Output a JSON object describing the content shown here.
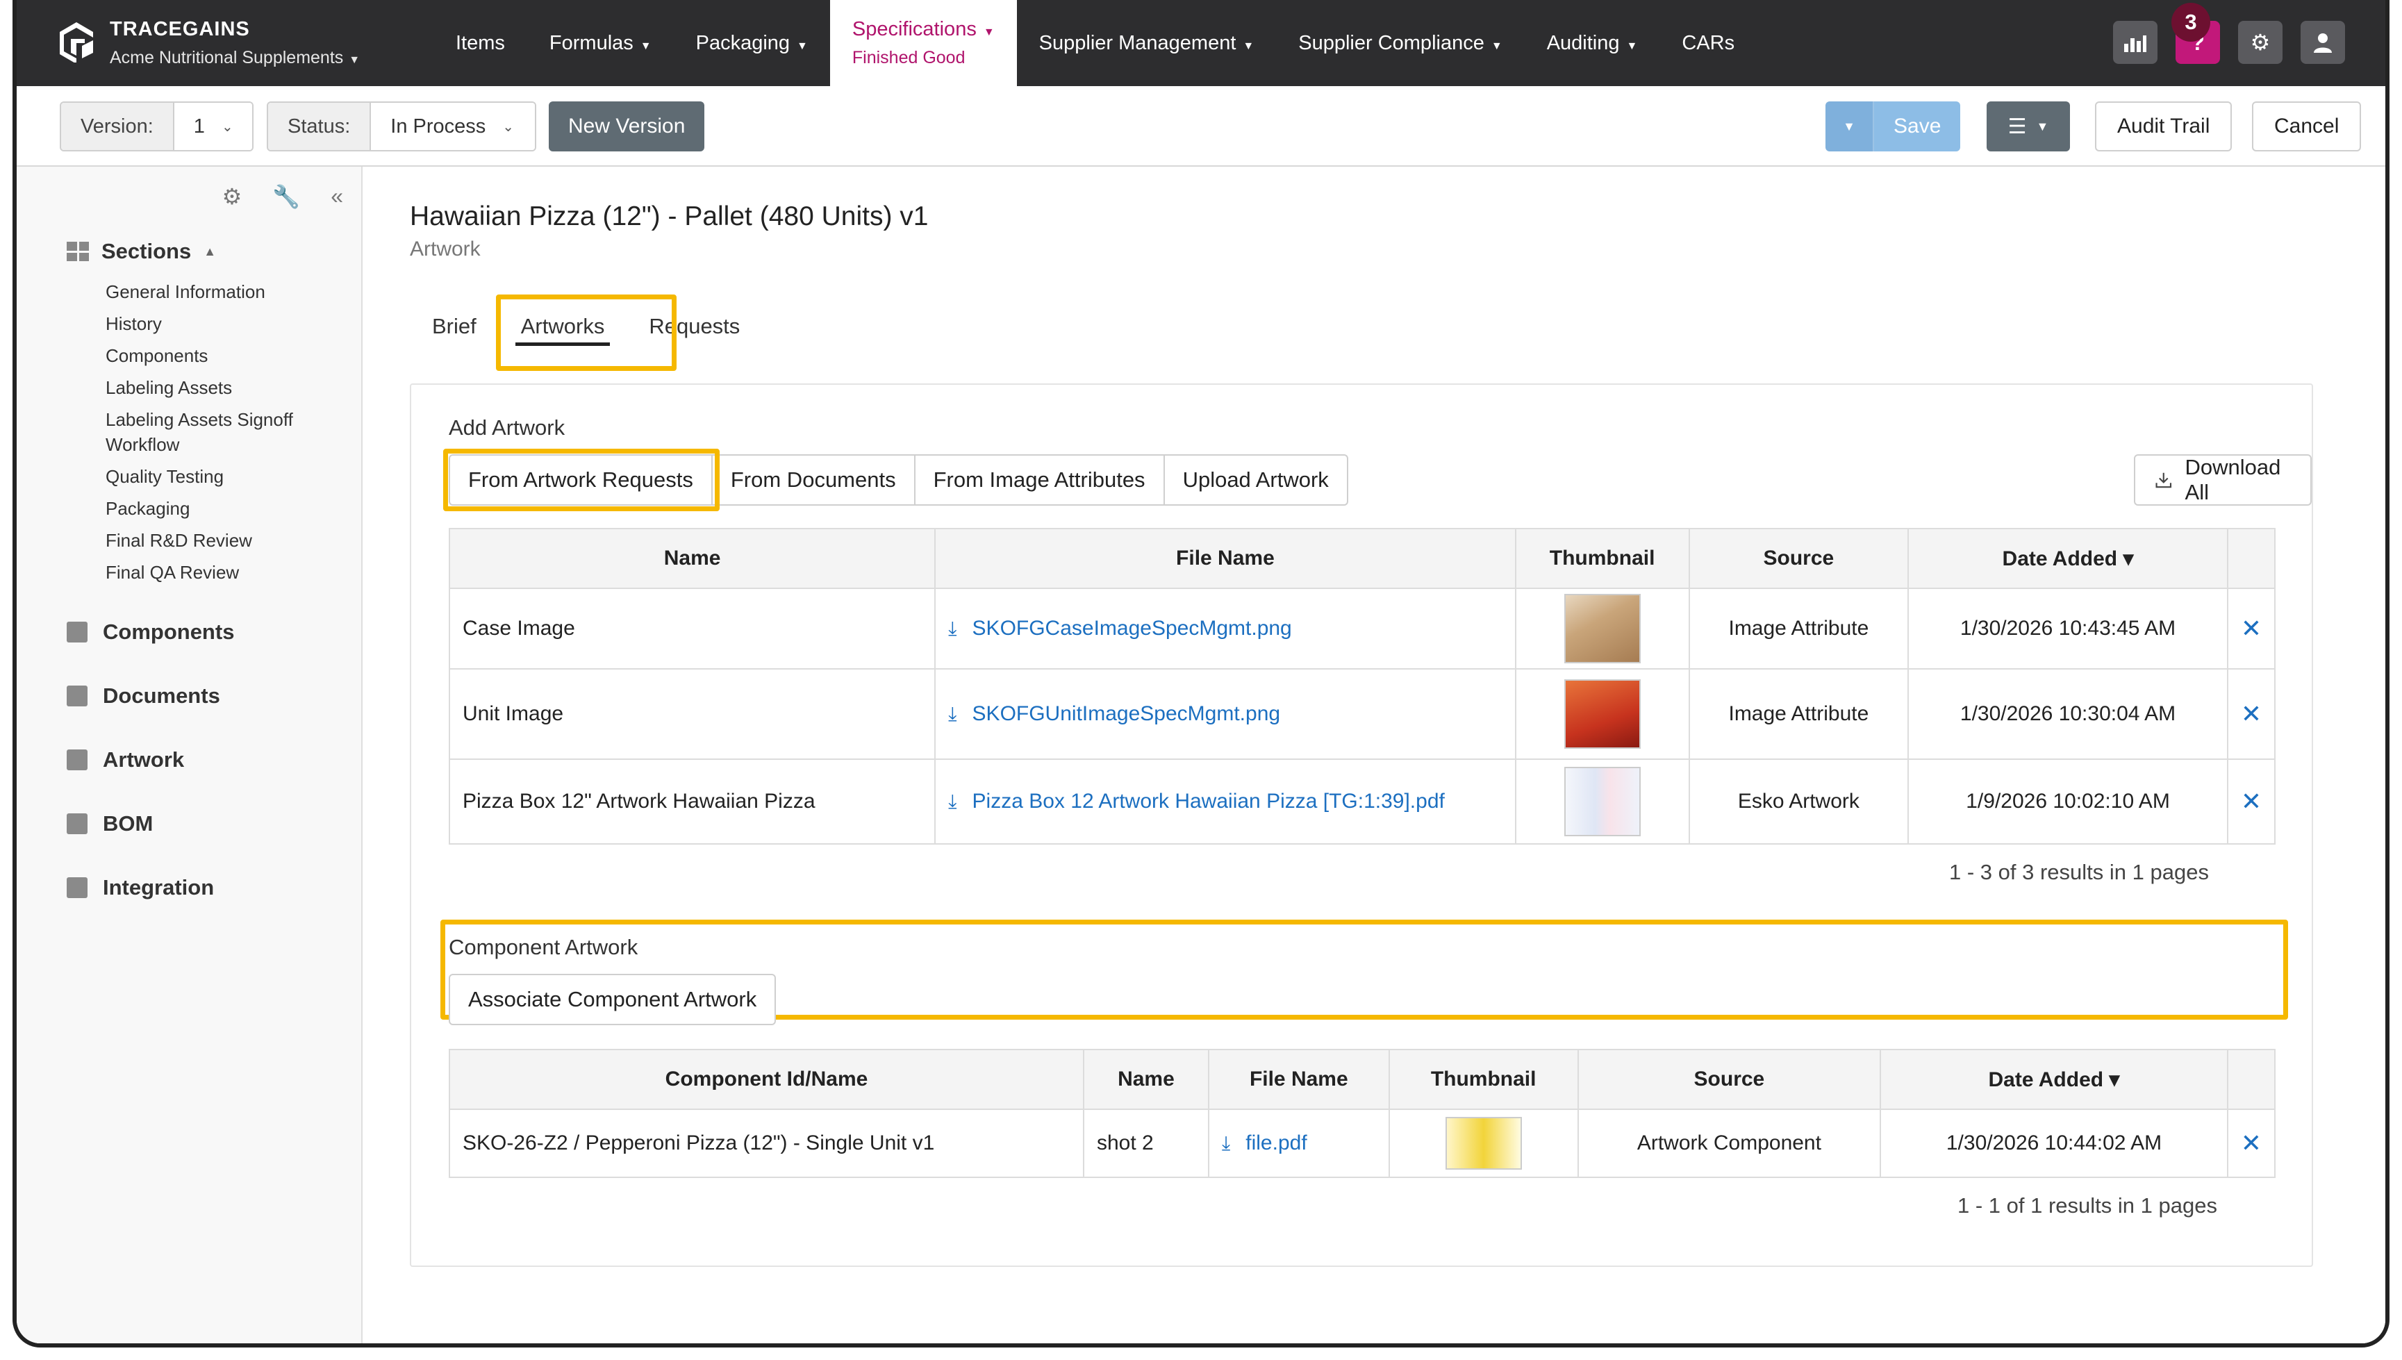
{
  "app": {
    "brand_name": "TRACEGAINS",
    "org_name": "Acme Nutritional Supplements"
  },
  "nav": {
    "items": [
      {
        "label": "Items",
        "caret": false
      },
      {
        "label": "Formulas",
        "caret": true
      },
      {
        "label": "Packaging",
        "caret": true
      },
      {
        "label": "Specifications",
        "caret": true,
        "sub": "Finished Good",
        "active": true
      },
      {
        "label": "Supplier Management",
        "caret": true
      },
      {
        "label": "Supplier Compliance",
        "caret": true
      },
      {
        "label": "Auditing",
        "caret": true
      },
      {
        "label": "CARs",
        "caret": false
      }
    ],
    "help_label": "?",
    "notification_count": "3"
  },
  "toolbar": {
    "version_label": "Version:",
    "version_value": "1",
    "status_label": "Status:",
    "status_value": "In Process",
    "new_version_label": "New Version",
    "save_label": "Save",
    "audit_trail_label": "Audit Trail",
    "cancel_label": "Cancel"
  },
  "sidebar": {
    "sections_heading": "Sections",
    "section_links": [
      "General Information",
      "History",
      "Components",
      "Labeling Assets",
      "Labeling Assets Signoff Workflow",
      "Quality Testing",
      "Packaging",
      "Final R&D Review",
      "Final QA Review"
    ],
    "groups": [
      "Components",
      "Documents",
      "Artwork",
      "BOM",
      "Integration"
    ]
  },
  "page": {
    "title": "Hawaiian Pizza (12\") - Pallet (480 Units) v1",
    "subtitle": "Artwork",
    "tabs": [
      "Brief",
      "Artworks",
      "Requests"
    ]
  },
  "add_artwork": {
    "heading": "Add Artwork",
    "buttons": [
      "From Artwork Requests",
      "From Documents",
      "From Image Attributes",
      "Upload Artwork"
    ],
    "download_all_label": "Download All",
    "columns": [
      "Name",
      "File Name",
      "Thumbnail",
      "Source",
      "Date Added ▾"
    ],
    "rows": [
      {
        "name": "Case Image",
        "file": "SKOFGCaseImageSpecMgmt.png",
        "source": "Image Attribute",
        "date": "1/30/2026 10:43:45 AM"
      },
      {
        "name": "Unit Image",
        "file": "SKOFGUnitImageSpecMgmt.png",
        "source": "Image Attribute",
        "date": "1/30/2026 10:30:04 AM"
      },
      {
        "name": "Pizza Box 12\" Artwork Hawaiian Pizza",
        "file": "Pizza Box 12 Artwork Hawaiian Pizza [TG:1:39].pdf",
        "source": "Esko Artwork",
        "date": "1/9/2026 10:02:10 AM"
      }
    ],
    "pager": "1 - 3 of 3 results in 1 pages"
  },
  "component_artwork": {
    "heading": "Component Artwork",
    "associate_label": "Associate Component Artwork",
    "columns": [
      "Component Id/Name",
      "Name",
      "File Name",
      "Thumbnail",
      "Source",
      "Date Added ▾"
    ],
    "rows": [
      {
        "component": "SKO-26-Z2 / Pepperoni Pizza (12\") - Single Unit v1",
        "name": "shot 2",
        "file": "file.pdf",
        "source": "Artwork Component",
        "date": "1/30/2026 10:44:02 AM"
      }
    ],
    "pager": "1 - 1 of 1 results in 1 pages"
  },
  "colors": {
    "nav_bg": "#2d2d2f",
    "accent": "#b0146c",
    "highlight": "#f5b800",
    "link": "#1c6fc0"
  }
}
